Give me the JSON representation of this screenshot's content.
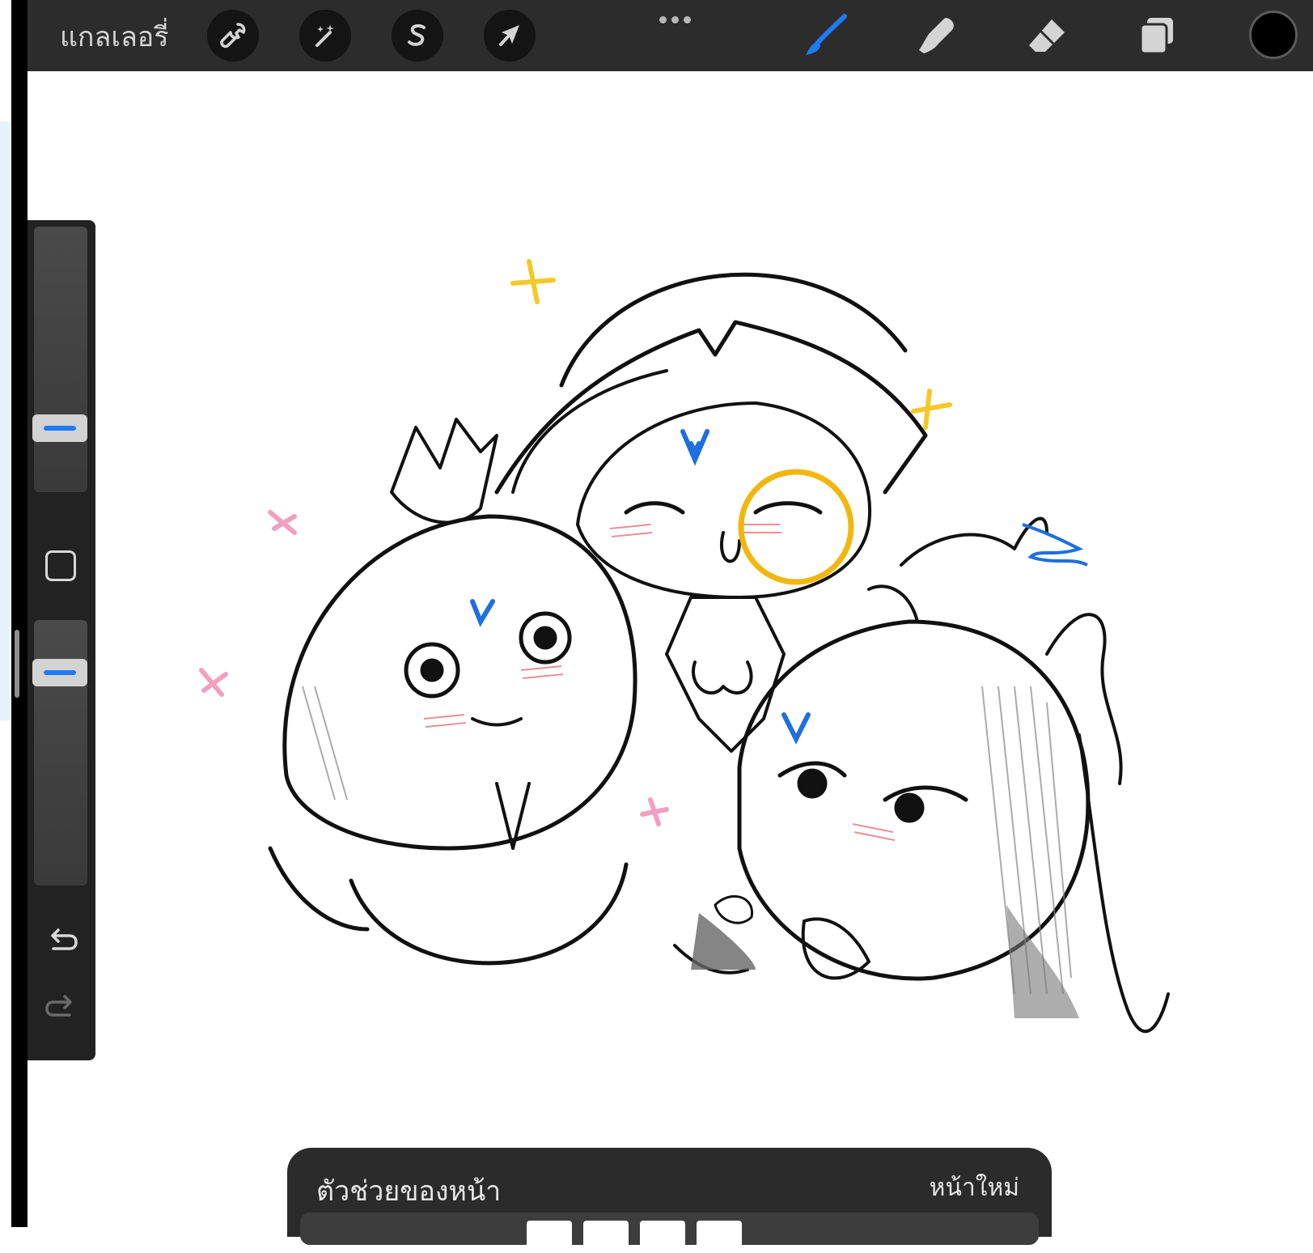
{
  "app": {
    "gallery_label": "แกลเลอรี่"
  },
  "toolbar": {
    "left_tools": [
      {
        "name": "actions",
        "icon": "wrench-icon"
      },
      {
        "name": "adjustments",
        "icon": "magic-wand-icon"
      },
      {
        "name": "selection",
        "icon": "selection-s-icon"
      },
      {
        "name": "transform",
        "icon": "arrow-cursor-icon"
      }
    ],
    "right_tools": [
      {
        "name": "brush",
        "icon": "brush-icon",
        "active": true
      },
      {
        "name": "smudge",
        "icon": "smudge-finger-icon"
      },
      {
        "name": "eraser",
        "icon": "eraser-icon"
      },
      {
        "name": "layers",
        "icon": "layers-icon"
      }
    ],
    "current_color": "#000000",
    "accent_color": "#1e7bf6"
  },
  "sidebar": {
    "brush_size_level": 0.24,
    "opacity_level": 0.22,
    "icons": [
      "square-modify-icon",
      "undo-icon",
      "redo-icon"
    ]
  },
  "page_assist": {
    "title": "ตัวช่วยของหน้า",
    "new_page": "หน้าใหม่"
  }
}
